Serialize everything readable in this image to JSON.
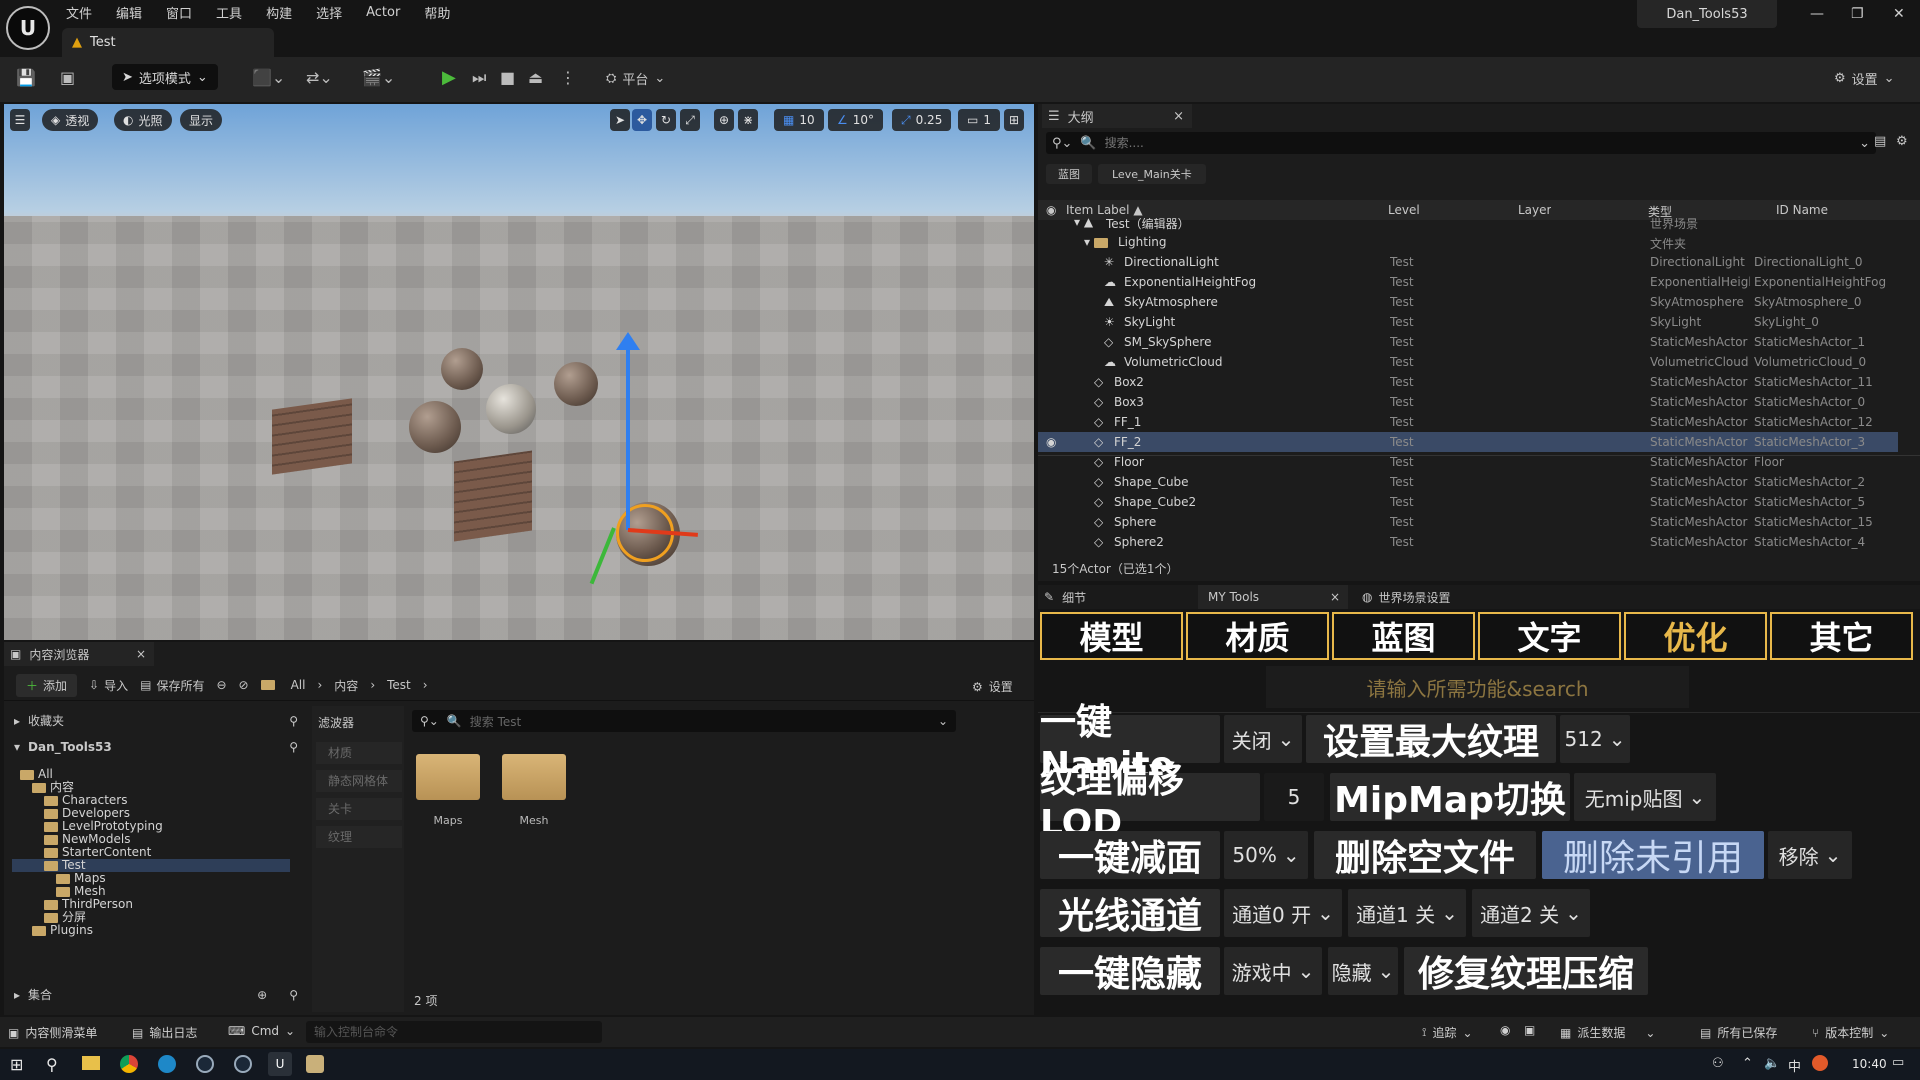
{
  "menu": [
    "文件",
    "编辑",
    "窗口",
    "工具",
    "构建",
    "选择",
    "Actor",
    "帮助"
  ],
  "doc_tab": "Test",
  "project_name": "Dan_Tools53",
  "toolbar": {
    "mode": "选项模式",
    "platform": "平台",
    "settings": "设置"
  },
  "viewport": {
    "perspective": "透视",
    "lit": "光照",
    "show": "显示",
    "grid": "10",
    "angle": "10°",
    "scale": "0.25",
    "camera": "1"
  },
  "outliner": {
    "title": "大纲",
    "search_placeholder": "搜索....",
    "filters": [
      "蓝图",
      "Leve_Main关卡"
    ],
    "columns": [
      "Item Label ▲",
      "Level",
      "Layer",
      "类型",
      "ID Name"
    ],
    "root": {
      "label": "Test（编辑器）",
      "type": "世界场景"
    },
    "folder": {
      "label": "Lighting",
      "type": "文件夹"
    },
    "rows": [
      {
        "label": "DirectionalLight",
        "level": "Test",
        "type": "DirectionalLight",
        "id": "DirectionalLight_0",
        "icon": "directional-light-icon",
        "indent": 2
      },
      {
        "label": "ExponentialHeightFog",
        "level": "Test",
        "type": "ExponentialHeightFog",
        "id": "ExponentialHeightFog",
        "icon": "fog-icon",
        "indent": 2
      },
      {
        "label": "SkyAtmosphere",
        "level": "Test",
        "type": "SkyAtmosphere",
        "id": "SkyAtmosphere_0",
        "icon": "sky-atmosphere-icon",
        "indent": 2
      },
      {
        "label": "SkyLight",
        "level": "Test",
        "type": "SkyLight",
        "id": "SkyLight_0",
        "icon": "sky-light-icon",
        "indent": 2
      },
      {
        "label": "SM_SkySphere",
        "level": "Test",
        "type": "StaticMeshActor",
        "id": "StaticMeshActor_1",
        "icon": "static-mesh-icon",
        "indent": 2
      },
      {
        "label": "VolumetricCloud",
        "level": "Test",
        "type": "VolumetricCloud",
        "id": "VolumetricCloud_0",
        "icon": "cloud-icon",
        "indent": 2
      },
      {
        "label": "Box2",
        "level": "Test",
        "type": "StaticMeshActor",
        "id": "StaticMeshActor_11",
        "icon": "static-mesh-icon",
        "indent": 1
      },
      {
        "label": "Box3",
        "level": "Test",
        "type": "StaticMeshActor",
        "id": "StaticMeshActor_0",
        "icon": "static-mesh-icon",
        "indent": 1
      },
      {
        "label": "FF_1",
        "level": "Test",
        "type": "StaticMeshActor",
        "id": "StaticMeshActor_12",
        "icon": "static-mesh-icon",
        "indent": 1
      },
      {
        "label": "FF_2",
        "level": "Test",
        "type": "StaticMeshActor",
        "id": "StaticMeshActor_3",
        "icon": "static-mesh-icon",
        "indent": 1,
        "selected": true
      },
      {
        "label": "Floor",
        "level": "Test",
        "type": "StaticMeshActor",
        "id": "Floor",
        "icon": "static-mesh-icon",
        "indent": 1
      },
      {
        "label": "Shape_Cube",
        "level": "Test",
        "type": "StaticMeshActor",
        "id": "StaticMeshActor_2",
        "icon": "static-mesh-icon",
        "indent": 1
      },
      {
        "label": "Shape_Cube2",
        "level": "Test",
        "type": "StaticMeshActor",
        "id": "StaticMeshActor_5",
        "icon": "static-mesh-icon",
        "indent": 1
      },
      {
        "label": "Sphere",
        "level": "Test",
        "type": "StaticMeshActor",
        "id": "StaticMeshActor_15",
        "icon": "static-mesh-icon",
        "indent": 1
      },
      {
        "label": "Sphere2",
        "level": "Test",
        "type": "StaticMeshActor",
        "id": "StaticMeshActor_4",
        "icon": "static-mesh-icon",
        "indent": 1
      }
    ],
    "footer": "15个Actor（已选1个）"
  },
  "details_tabs": {
    "details": "细节",
    "my_tools": "MY Tools",
    "world": "世界场景设置"
  },
  "mytools": {
    "categories": [
      "模型",
      "材质",
      "蓝图",
      "文字",
      "优化",
      "其它"
    ],
    "active_category": "优化",
    "search_placeholder": "请输入所需功能&search",
    "row1": {
      "nanite": "一键Nanite",
      "nanite_opt": "关闭",
      "max_tex": "设置最大纹理",
      "max_tex_opt": "512"
    },
    "row2": {
      "lod": "纹理偏移LOD",
      "lod_val": "5",
      "mip": "MipMap切换",
      "mip_opt": "无mip贴图"
    },
    "row3": {
      "reduce": "一键减面",
      "reduce_opt": "50%",
      "del_empty": "删除空文件",
      "del_unref": "删除未引用",
      "del_opt": "移除"
    },
    "row4": {
      "light": "光线通道",
      "ch0": "通道0 开",
      "ch1": "通道1 关",
      "ch2": "通道2 关"
    },
    "row5": {
      "hide": "一键隐藏",
      "hide_opt1": "游戏中",
      "hide_opt2": "隐藏",
      "fix": "修复纹理压缩"
    },
    "accent": "#e8b84a"
  },
  "content_browser": {
    "title": "内容浏览器",
    "add": "添加",
    "import": "导入",
    "save_all": "保存所有",
    "path": [
      "All",
      "内容",
      "Test"
    ],
    "settings": "设置",
    "favorites": "收藏夹",
    "project": "Dan_Tools53",
    "tree": [
      {
        "label": "All",
        "indent": 0
      },
      {
        "label": "内容",
        "indent": 1
      },
      {
        "label": "Characters",
        "indent": 2
      },
      {
        "label": "Developers",
        "indent": 2
      },
      {
        "label": "LevelPrototyping",
        "indent": 2
      },
      {
        "label": "NewModels",
        "indent": 2
      },
      {
        "label": "StarterContent",
        "indent": 2
      },
      {
        "label": "Test",
        "indent": 2,
        "selected": true
      },
      {
        "label": "Maps",
        "indent": 3
      },
      {
        "label": "Mesh",
        "indent": 3
      },
      {
        "label": "ThirdPerson",
        "indent": 2
      },
      {
        "label": "分屏",
        "indent": 2
      },
      {
        "label": "Plugins",
        "indent": 1
      }
    ],
    "collections": "集合",
    "filters_title": "滤波器",
    "filters": [
      "材质",
      "静态网格体",
      "关卡",
      "纹理"
    ],
    "search_placeholder": "搜索 Test",
    "folders": [
      "Maps",
      "Mesh"
    ],
    "count": "2 项"
  },
  "statusbar": {
    "drawer": "内容侧滑菜单",
    "log": "输出日志",
    "cmd": "Cmd",
    "console_placeholder": "输入控制台命令",
    "trace": "追踪",
    "derived": "派生数据",
    "saved": "所有已保存",
    "vcs": "版本控制"
  },
  "taskbar": {
    "time": "10:40"
  }
}
